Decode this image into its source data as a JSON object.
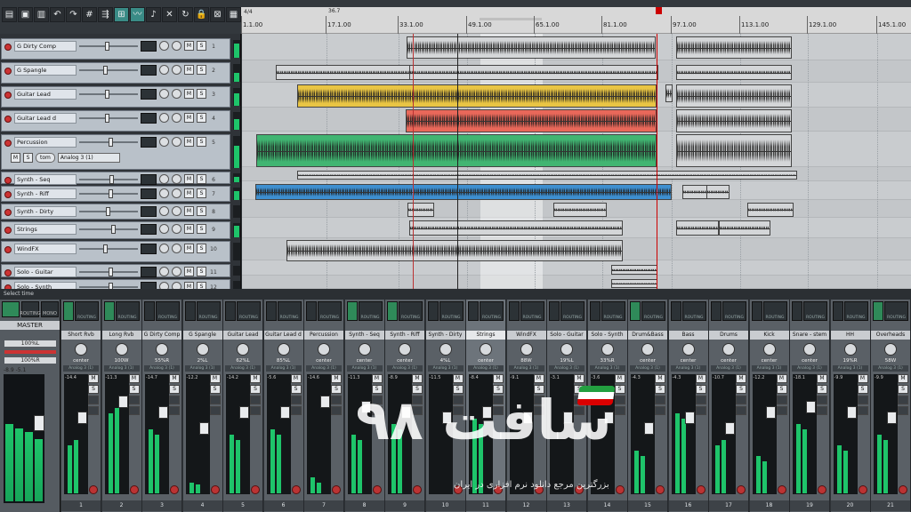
{
  "toolbar": {
    "tools": [
      "new-project",
      "open-project",
      "save-project",
      "undo",
      "redo",
      "grid",
      "ripple",
      "snap",
      "envelope",
      "metronome",
      "cross",
      "loop",
      "lock",
      "locked",
      "overlap"
    ],
    "active": [
      7,
      8
    ]
  },
  "ruler": {
    "time_signature": "4/4",
    "marker_label": "36.7",
    "ticks": [
      "1.1.00",
      "17.1.00",
      "33.1.00",
      "49.1.00",
      "65.1.00",
      "81.1.00",
      "97.1.00",
      "113.1.00",
      "129.1.00",
      "145.1.00"
    ]
  },
  "status": {
    "text": "Select time"
  },
  "tracks": [
    {
      "name": "G Dirty Comp",
      "num": "1",
      "fader": 0.48,
      "meter": 0.8
    },
    {
      "name": "G Spangle",
      "num": "2",
      "fader": 0.45,
      "meter": 0.5
    },
    {
      "name": "Guitar Lead",
      "num": "3",
      "fader": 0.48,
      "meter": 0.7
    },
    {
      "name": "Guitar Lead d",
      "num": "4",
      "fader": 0.48,
      "meter": 0.6
    },
    {
      "name": "Percussion",
      "num": "5",
      "fader": 0.55,
      "meter": 0.7,
      "input": "Analog 3 (1)",
      "mode": "tom"
    },
    {
      "name": "Synth - Seq",
      "num": "6",
      "fader": 0.56,
      "meter": 0.6
    },
    {
      "name": "Synth - Riff",
      "num": "7",
      "fader": 0.55,
      "meter": 0.7
    },
    {
      "name": "Synth - Dirty",
      "num": "8",
      "fader": 0.5,
      "meter": 0.0
    },
    {
      "name": "Strings",
      "num": "9",
      "fader": 0.6,
      "meter": 0.8
    },
    {
      "name": "WindFX",
      "num": "10",
      "fader": 0.45,
      "meter": 0.0
    },
    {
      "name": "Solo - Guitar",
      "num": "11",
      "fader": 0.55,
      "meter": 0.0
    },
    {
      "name": "Solo - Synth",
      "num": "12",
      "fader": 0.55,
      "meter": 0.0
    }
  ],
  "master": {
    "name": "MASTER",
    "volume": "100%L",
    "pan": "100%R",
    "readout": "-8.9  -5.1",
    "routing_label": "ROUTING",
    "mono_label": "MONO",
    "levels": [
      0.62,
      0.58,
      0.55,
      0.5
    ]
  },
  "mixer": [
    {
      "name": "Short Rvb",
      "num": "1",
      "width": "center",
      "peak": "-14.4",
      "l": 0.45,
      "r": 0.5,
      "fader": 0.35,
      "fx": true
    },
    {
      "name": "Long Rvb",
      "num": "2",
      "width": "100W",
      "peak": "-11.3",
      "l": 0.75,
      "r": 0.8,
      "fader": 0.2,
      "fx": true
    },
    {
      "name": "G Dirty Comp",
      "num": "3",
      "width": "55%R",
      "peak": "-14.7",
      "l": 0.6,
      "r": 0.55,
      "fader": 0.3,
      "fx": false
    },
    {
      "name": "G Spangle",
      "num": "4",
      "width": "2%L",
      "peak": "-12.2",
      "l": 0.1,
      "r": 0.08,
      "fader": 0.45,
      "fx": false
    },
    {
      "name": "Guitar Lead",
      "num": "5",
      "width": "62%L",
      "peak": "-14.2",
      "l": 0.55,
      "r": 0.5,
      "fader": 0.3,
      "fx": false
    },
    {
      "name": "Guitar Lead d",
      "num": "6",
      "width": "85%L",
      "peak": "-5.6",
      "l": 0.6,
      "r": 0.55,
      "fader": 0.3,
      "fx": false
    },
    {
      "name": "Percussion",
      "num": "7",
      "width": "center",
      "peak": "-14.6",
      "l": 0.15,
      "r": 0.1,
      "fader": 0.2,
      "fx": false
    },
    {
      "name": "Synth - Seq",
      "num": "8",
      "width": "center",
      "peak": "-11.3",
      "l": 0.55,
      "r": 0.5,
      "fader": 0.25,
      "fx": true
    },
    {
      "name": "Synth - Riff",
      "num": "9",
      "width": "center",
      "peak": "-8.9",
      "l": 0.65,
      "r": 0.6,
      "fader": 0.3,
      "fx": true
    },
    {
      "name": "Synth - Dirty",
      "num": "10",
      "width": "4%L",
      "peak": "-11.5",
      "l": 0.0,
      "r": 0.0,
      "fader": 0.35,
      "fx": false
    },
    {
      "name": "Strings",
      "num": "11",
      "width": "center",
      "peak": "-8.4",
      "l": 0.7,
      "r": 0.65,
      "fader": 0.3,
      "fx": false
    },
    {
      "name": "WindFX",
      "num": "12",
      "width": "88W",
      "peak": "-9.1",
      "l": 0.0,
      "r": 0.0,
      "fader": 0.35,
      "fx": false
    },
    {
      "name": "Solo - Guitar",
      "num": "13",
      "width": "19%L",
      "peak": "-3.1",
      "l": 0.0,
      "r": 0.0,
      "fader": 0.35,
      "fx": false
    },
    {
      "name": "Solo - Synth",
      "num": "14",
      "width": "33%R",
      "peak": "-3.6",
      "l": 0.0,
      "r": 0.0,
      "fader": 0.35,
      "fx": false
    },
    {
      "name": "Drum&Bass",
      "num": "15",
      "width": "center",
      "peak": "-4.3",
      "l": 0.4,
      "r": 0.35,
      "fader": 0.45,
      "fx": true
    },
    {
      "name": "Bass",
      "num": "16",
      "width": "center",
      "peak": "-4.3",
      "l": 0.75,
      "r": 0.7,
      "fader": 0.35,
      "fx": false
    },
    {
      "name": "Drums",
      "num": "17",
      "width": "center",
      "peak": "-10.7",
      "l": 0.45,
      "r": 0.5,
      "fader": 0.45,
      "fx": false
    },
    {
      "name": "Kick",
      "num": "18",
      "width": "center",
      "peak": "-12.2",
      "l": 0.35,
      "r": 0.3,
      "fader": 0.3,
      "fx": false
    },
    {
      "name": "Snare - stem",
      "num": "19",
      "width": "center",
      "peak": "-18.1",
      "l": 0.65,
      "r": 0.6,
      "fader": 0.25,
      "fx": false
    },
    {
      "name": "HH",
      "num": "20",
      "width": "19%R",
      "peak": "-9.9",
      "l": 0.45,
      "r": 0.4,
      "fader": 0.3,
      "fx": false
    },
    {
      "name": "Overheads",
      "num": "21",
      "width": "58W",
      "peak": "-9.9",
      "l": 0.55,
      "r": 0.5,
      "fader": 0.35,
      "fx": true
    }
  ],
  "strip_labels": {
    "routing": "ROUTING",
    "input": "Analog 3 (1)",
    "mute": "M",
    "solo": "S"
  },
  "watermark": {
    "text": "سافت ۹۸",
    "subtitle": "بزرگترین مرجع دانلود نرم افزاری در ایران"
  },
  "colors": {
    "guitar_lead": "#e9c544",
    "guitar_lead_d": "#e9685a",
    "percussion": "#41b572",
    "synth_riff": "#3e8fd0",
    "default_item": "#d4d6d8",
    "playhead": "#cc0000",
    "meter": "#1ec46a"
  }
}
